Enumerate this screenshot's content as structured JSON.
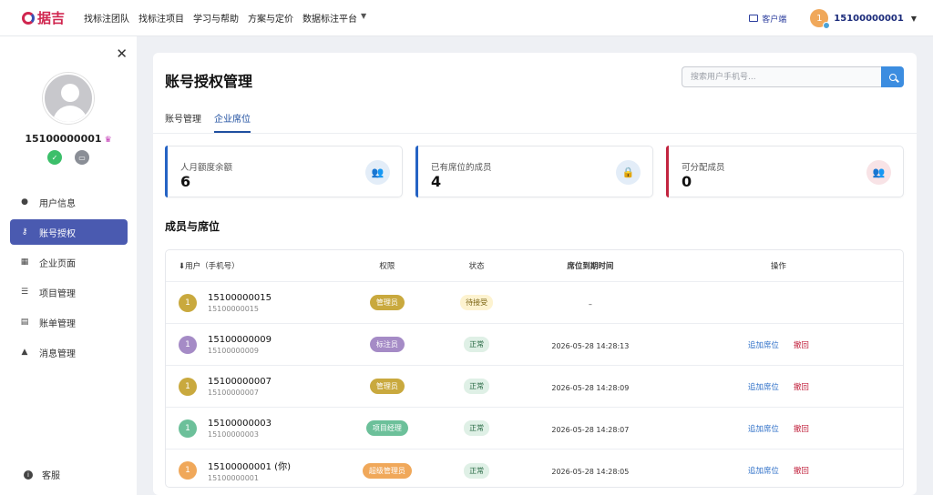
{
  "topbar": {
    "logo_text": "据吉",
    "nav": [
      "找标注团队",
      "找标注项目",
      "学习与帮助",
      "方案与定价",
      "数据标注平台"
    ],
    "client_label": "客户端",
    "avatar_initial": "1",
    "username": "15100000001"
  },
  "sidebar": {
    "username": "15100000001",
    "items": [
      {
        "label": "用户信息",
        "icon": "user-icon"
      },
      {
        "label": "账号授权",
        "icon": "key-icon"
      },
      {
        "label": "企业页面",
        "icon": "store-icon"
      },
      {
        "label": "项目管理",
        "icon": "list-icon"
      },
      {
        "label": "账单管理",
        "icon": "bill-icon"
      },
      {
        "label": "消息管理",
        "icon": "bell-icon"
      }
    ],
    "support_label": "客服"
  },
  "main": {
    "title": "账号授权管理",
    "search_placeholder": "搜索用户手机号...",
    "tabs": [
      "账号管理",
      "企业席位"
    ],
    "stats": [
      {
        "label": "人月额度余额",
        "value": "6",
        "color": "#2563c4"
      },
      {
        "label": "已有席位的成员",
        "value": "4",
        "color": "#2563c4"
      },
      {
        "label": "可分配成员",
        "value": "0",
        "color": "#c2243f"
      }
    ],
    "section_title": "成员与席位",
    "table": {
      "headers": [
        "⬇用户（手机号）",
        "权限",
        "状态",
        "席位到期时间",
        "操作"
      ],
      "rows": [
        {
          "initial": "1",
          "avatar_color": "#c9a93e",
          "name": "15100000015",
          "sub": "15100000015",
          "role": "管理员",
          "role_color": "#c9a93e",
          "status": "待接受",
          "status_bg": "#fdf3d0",
          "status_fg": "#7a6310",
          "expire": "–",
          "ops": []
        },
        {
          "initial": "1",
          "avatar_color": "#a58bc6",
          "name": "15100000009",
          "sub": "15100000009",
          "role": "标注员",
          "role_color": "#a58bc6",
          "status": "正常",
          "status_bg": "#dff0e6",
          "status_fg": "#2a6a45",
          "expire": "2026-05-28 14:28:13",
          "ops": [
            "追加席位",
            "撤回"
          ]
        },
        {
          "initial": "1",
          "avatar_color": "#c9a93e",
          "name": "15100000007",
          "sub": "15100000007",
          "role": "管理员",
          "role_color": "#c9a93e",
          "status": "正常",
          "status_bg": "#dff0e6",
          "status_fg": "#2a6a45",
          "expire": "2026-05-28 14:28:09",
          "ops": [
            "追加席位",
            "撤回"
          ]
        },
        {
          "initial": "1",
          "avatar_color": "#6cc09a",
          "name": "15100000003",
          "sub": "15100000003",
          "role": "项目经理",
          "role_color": "#6cc09a",
          "status": "正常",
          "status_bg": "#dff0e6",
          "status_fg": "#2a6a45",
          "expire": "2026-05-28 14:28:07",
          "ops": [
            "追加席位",
            "撤回"
          ]
        },
        {
          "initial": "1",
          "avatar_color": "#f0a85a",
          "name": "15100000001 (你)",
          "sub": "15100000001",
          "role": "超级管理员",
          "role_color": "#f0a85a",
          "status": "正常",
          "status_bg": "#dff0e6",
          "status_fg": "#2a6a45",
          "expire": "2026-05-28 14:28:05",
          "ops": [
            "追加席位",
            "撤回"
          ]
        }
      ]
    }
  }
}
